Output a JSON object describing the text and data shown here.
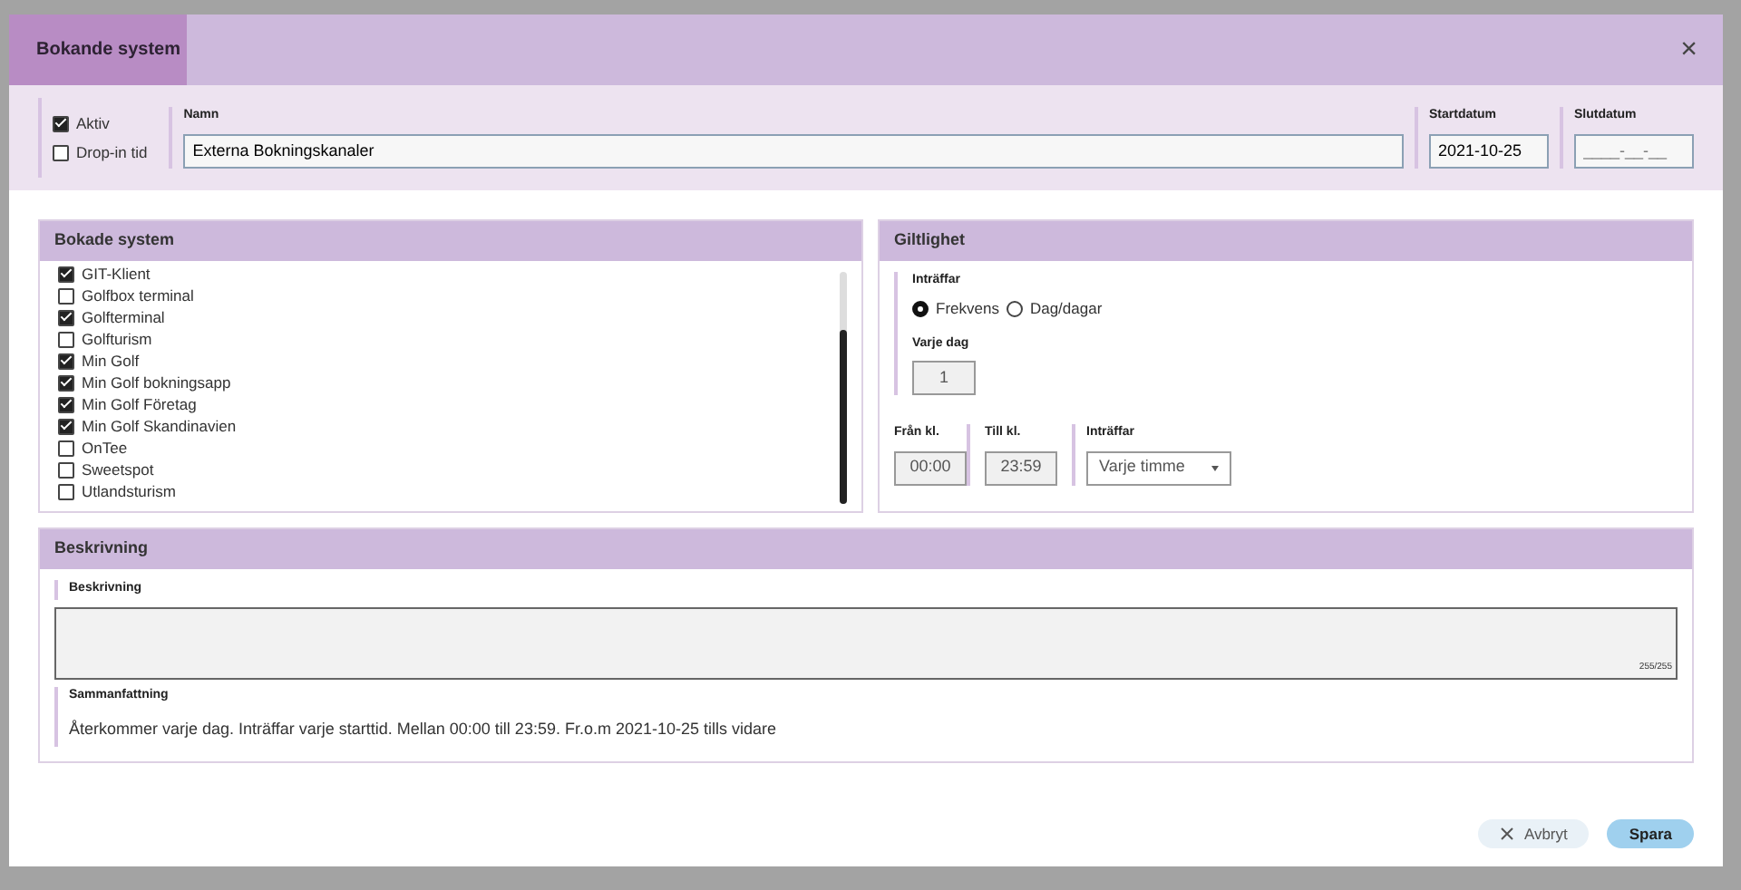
{
  "dialog": {
    "title": "Bokande system",
    "close": "×"
  },
  "top": {
    "active": {
      "label": "Aktiv",
      "checked": true
    },
    "dropin": {
      "label": "Drop-in tid",
      "checked": false
    },
    "name": {
      "label": "Namn",
      "value": "Externa Bokningskanaler"
    },
    "start": {
      "label": "Startdatum",
      "value": "2021-10-25"
    },
    "end": {
      "label": "Slutdatum",
      "placeholder": "____-__-__"
    }
  },
  "systems": {
    "title": "Bokade system",
    "items": [
      {
        "label": "GIT-Klient",
        "checked": true
      },
      {
        "label": "Golfbox terminal",
        "checked": false
      },
      {
        "label": "Golfterminal",
        "checked": true
      },
      {
        "label": "Golfturism",
        "checked": false
      },
      {
        "label": "Min Golf",
        "checked": true
      },
      {
        "label": "Min Golf bokningsapp",
        "checked": true
      },
      {
        "label": "Min Golf Företag",
        "checked": true
      },
      {
        "label": "Min Golf Skandinavien",
        "checked": true
      },
      {
        "label": "OnTee",
        "checked": false
      },
      {
        "label": "Sweetspot",
        "checked": false
      },
      {
        "label": "Utlandsturism",
        "checked": false
      }
    ]
  },
  "validity": {
    "title": "Giltlighet",
    "occurs_label": "Inträffar",
    "options": [
      {
        "label": "Frekvens",
        "selected": true
      },
      {
        "label": "Dag/dagar",
        "selected": false
      }
    ],
    "every_day": {
      "label": "Varje dag",
      "value": "1"
    },
    "from": {
      "label": "Från kl.",
      "value": "00:00"
    },
    "to": {
      "label": "Till kl.",
      "value": "23:59"
    },
    "repeat": {
      "label": "Inträffar",
      "value": "Varje timme"
    }
  },
  "description": {
    "title": "Beskrivning",
    "field_label": "Beskrivning",
    "counter": "255/255",
    "summary_label": "Sammanfattning",
    "summary": "Återkommer varje dag. Inträffar varje starttid. Mellan 00:00 till 23:59. Fr.o.m 2021-10-25 tills vidare"
  },
  "buttons": [
    {
      "kind": "cancel",
      "label": "Avbryt"
    },
    {
      "kind": "save",
      "label": "Spara"
    }
  ]
}
